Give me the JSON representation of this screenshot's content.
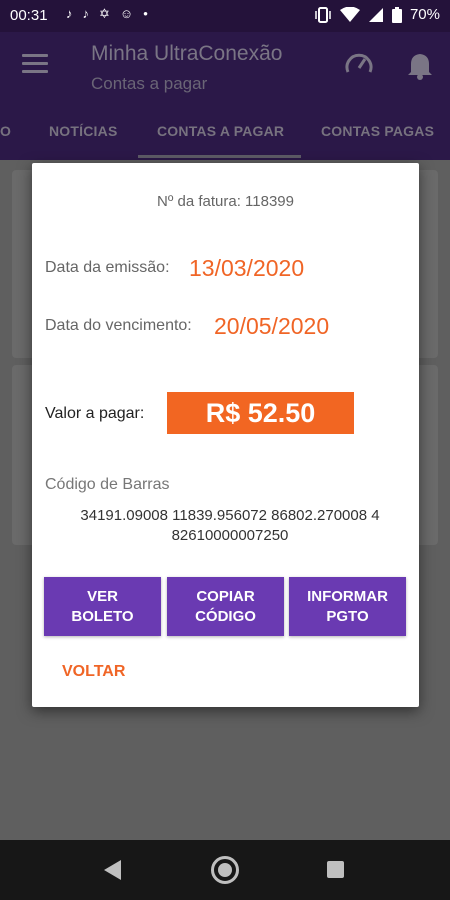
{
  "status_bar": {
    "time": "00:31",
    "battery": "70%",
    "left_icons": [
      "tiktok-icon",
      "tiktok-icon",
      "pinwheel-icon",
      "smiley-icon",
      "dot-icon"
    ],
    "right_icons": [
      "vibrate-icon",
      "wifi-icon",
      "signal-icon",
      "battery-icon"
    ]
  },
  "app_bar": {
    "title": "Minha UltraConexão",
    "subtitle": "Contas a pagar"
  },
  "tabs": [
    {
      "label": "O"
    },
    {
      "label": "NOTÍCIAS"
    },
    {
      "label": "CONTAS A PAGAR"
    },
    {
      "label": "CONTAS PAGAS"
    }
  ],
  "dialog": {
    "invoice_number": "Nº da fatura: 118399",
    "emissao_label": "Data da emissão:",
    "emissao_value": "13/03/2020",
    "vencimento_label": "Data do vencimento:",
    "vencimento_value": "20/05/2020",
    "valor_label": "Valor a pagar:",
    "valor_value": "R$ 52.50",
    "barcode_label": "Código de Barras",
    "barcode_line1": "34191.09008 11839.956072 86802.270008 4",
    "barcode_line2": "82610000007250",
    "btn_ver_boleto_1": "VER",
    "btn_ver_boleto_2": "BOLETO",
    "btn_copiar_1": "COPIAR",
    "btn_copiar_2": "CÓDIGO",
    "btn_informar_1": "INFORMAR",
    "btn_informar_2": "PGTO",
    "voltar": "VOLTAR"
  },
  "colors": {
    "accent": "#f06526",
    "button": "#6a3ab2",
    "appbar": "#2b1848"
  }
}
